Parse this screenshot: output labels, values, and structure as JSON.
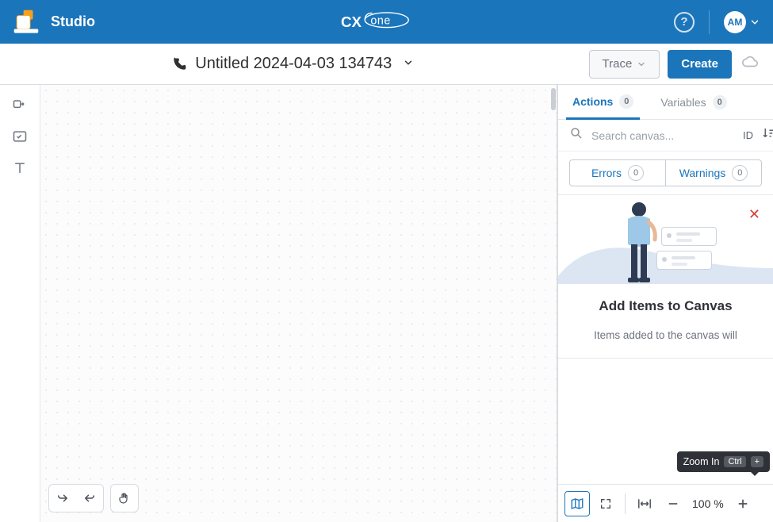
{
  "app_name": "Studio",
  "brand": "CXone",
  "user_initials": "AM",
  "doc_title": "Untitled 2024-04-03 134743",
  "buttons": {
    "trace": "Trace",
    "create": "Create"
  },
  "tabs": {
    "actions": {
      "label": "Actions",
      "count": "0"
    },
    "variables": {
      "label": "Variables",
      "count": "0"
    }
  },
  "search": {
    "placeholder": "Search canvas...",
    "id_label": "ID"
  },
  "errors": {
    "label": "Errors",
    "count": "0"
  },
  "warnings": {
    "label": "Warnings",
    "count": "0"
  },
  "empty": {
    "title": "Add Items to Canvas",
    "subtitle": "Items added to the canvas will"
  },
  "zoom": {
    "level": "100 %"
  },
  "tooltip": {
    "label": "Zoom In",
    "key1": "Ctrl",
    "key2": "+"
  }
}
